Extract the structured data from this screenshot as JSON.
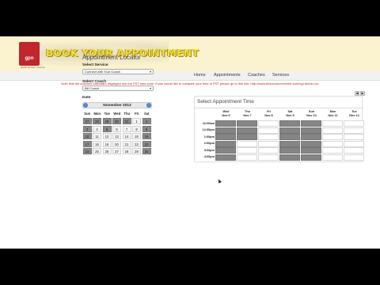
{
  "brand": {
    "logo_text": "gpn",
    "logo_sub": "global premier network",
    "title": "BOOK YOUR APPOINTMENT"
  },
  "nav": {
    "items": [
      "Home",
      "Appointments",
      "Coaches",
      "Services"
    ]
  },
  "notice": "Note that the coaches calendars displayed use the PST time zone. If you would like to compare your time to PST please go to this link: http://www.timezoneconverter.com/cgi-bin/tzc.tzc",
  "locator": {
    "title": "Appointment Locator",
    "service_label": "Select Service",
    "service_value": "Connect with Your Coach",
    "coach_label": "Select Coach",
    "coach_value": "Bill Coach",
    "date_label": "Date"
  },
  "calendar": {
    "month": "November 2013",
    "prev": "‹",
    "next": "›",
    "dow": [
      "Sun",
      "Mon",
      "Tue",
      "Wed",
      "Thu",
      "Fri",
      "Sat"
    ],
    "weeks": [
      [
        "27",
        "28",
        "29",
        "30",
        "31",
        "1",
        "2"
      ],
      [
        "3",
        "4",
        "5",
        "6",
        "7",
        "8",
        "9"
      ],
      [
        "10",
        "11",
        "12",
        "13",
        "14",
        "15",
        "16"
      ],
      [
        "17",
        "18",
        "19",
        "20",
        "21",
        "22",
        "23"
      ],
      [
        "24",
        "25",
        "26",
        "27",
        "28",
        "29",
        "30"
      ]
    ],
    "dark_cells": [
      "0-0",
      "0-1",
      "0-2",
      "0-3",
      "0-4",
      "0-6",
      "1-0",
      "1-2",
      "1-6",
      "2-0",
      "2-6",
      "3-0",
      "3-6",
      "4-0",
      "4-6"
    ]
  },
  "schedule": {
    "title": "Select Appointment Time",
    "prev_button": "◀",
    "next_button": "▶",
    "columns": [
      {
        "day": "Wed",
        "date": "Nov 6"
      },
      {
        "day": "Thu",
        "date": "Nov 7"
      },
      {
        "day": "Fri",
        "date": "Nov 8"
      },
      {
        "day": "Sat",
        "date": "Nov 9"
      },
      {
        "day": "Sun",
        "date": "Nov 10"
      },
      {
        "day": "Mon",
        "date": "Nov 11"
      },
      {
        "day": "Tue",
        "date": "Nov 12"
      }
    ],
    "times": [
      "11:00am",
      "12:00pm",
      "1:00pm",
      "2:00pm",
      "3:00pm",
      "4:00pm"
    ],
    "booked": [
      "0-0",
      "0-1",
      "0-3",
      "0-4",
      "1-0",
      "1-1",
      "1-3",
      "1-4",
      "2-0",
      "2-1",
      "2-3",
      "2-4",
      "3-0",
      "3-3",
      "3-4",
      "4-0",
      "4-3",
      "4-4",
      "5-0",
      "5-3",
      "5-4"
    ],
    "colors": {
      "booked": "#858585",
      "open": "#ffffff"
    }
  }
}
